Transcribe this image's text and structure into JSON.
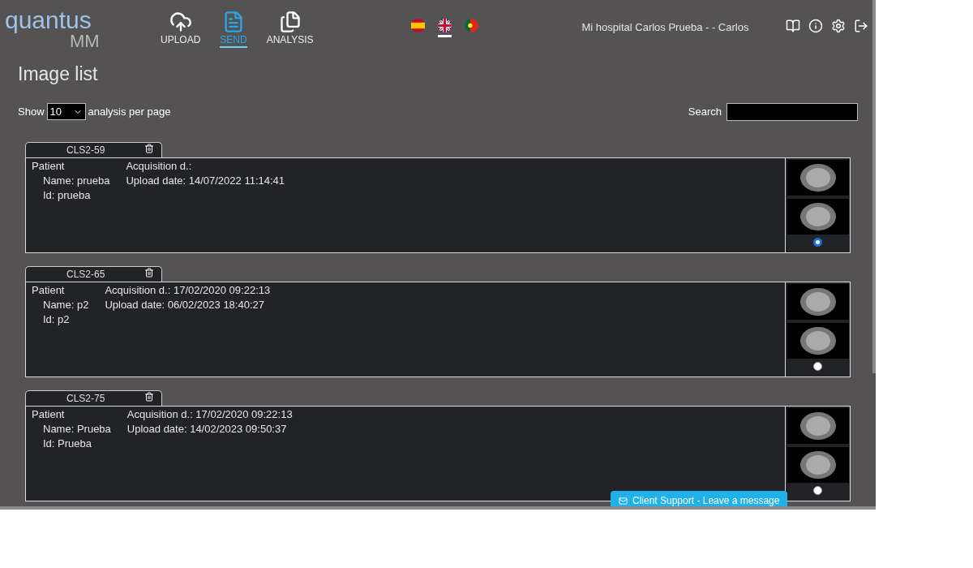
{
  "logo": {
    "word": "quantus",
    "sub": "MM"
  },
  "nav": [
    {
      "label": "UPLOAD",
      "kind": "upload",
      "selected": false
    },
    {
      "label": "SEND",
      "kind": "send",
      "selected": true
    },
    {
      "label": "ANALYSIS",
      "kind": "analysis",
      "selected": false
    }
  ],
  "languages": [
    {
      "kind": "es",
      "selected": false
    },
    {
      "kind": "en",
      "selected": true
    },
    {
      "kind": "pt",
      "selected": false
    }
  ],
  "user": "Mi hospital Carlos Prueba - - Carlos",
  "title": "Image list",
  "page_size": {
    "before": "Show",
    "value": "10",
    "after": "analysis per page"
  },
  "search": {
    "label": "Search"
  },
  "analyses": [
    {
      "code": "CLS2-59",
      "patient": "Patient",
      "name": "Name: prueba",
      "id": "Id: prueba",
      "acquisition": "Acquisition d.:",
      "upload": "Upload date: 14/07/2022 11:14:41",
      "selected": true
    },
    {
      "code": "CLS2-65",
      "patient": "Patient",
      "name": "Name: p2",
      "id": "Id: p2",
      "acquisition": "Acquisition d.: 17/02/2020 09:22:13",
      "upload": "Upload date: 06/02/2023 18:40:27",
      "selected": false
    },
    {
      "code": "CLS2-75",
      "patient": "Patient",
      "name": "Name: Prueba",
      "id": "Id: Prueba",
      "acquisition": "Acquisition d.: 17/02/2020 09:22:13",
      "upload": "Upload date: 14/02/2023 09:50:37",
      "selected": false
    }
  ],
  "support": "Client Support - Leave a message"
}
